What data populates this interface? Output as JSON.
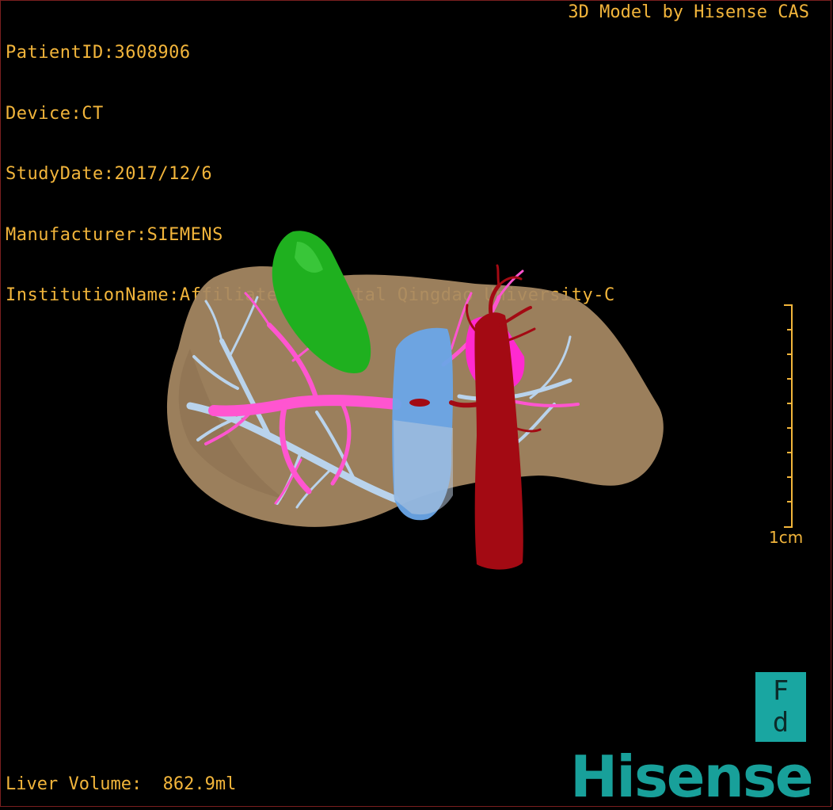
{
  "patient": {
    "id_line": "PatientID:3608906",
    "device_line": "Device:CT",
    "study_date_line": "StudyDate:2017/12/6",
    "manufacturer_line": "Manufacturer:SIEMENS",
    "institution_line": "InstitutionName:Affiliated Hospital Qingdao University-C"
  },
  "header": {
    "model_credit": "3D Model by Hisense CAS"
  },
  "footer": {
    "liver_volume": "Liver Volume:  862.9ml"
  },
  "scale_bar": {
    "label": "1cm",
    "color": "#f2b53b"
  },
  "orientation_cube": {
    "top_glyph": "F",
    "bottom_glyph": "d",
    "color": "#19a6a1"
  },
  "logo": {
    "text": "Hisense",
    "color": "#18a09a"
  },
  "colors": {
    "background": "#000000",
    "text": "#f2b53b",
    "liver": "#a88a64",
    "gallbladder": "#1fb01f",
    "hepatic_veins": "#b9d3ec",
    "portal_vein": "#ff55d0",
    "ivc": "#6aa6e8",
    "aorta": "#a30a13"
  }
}
